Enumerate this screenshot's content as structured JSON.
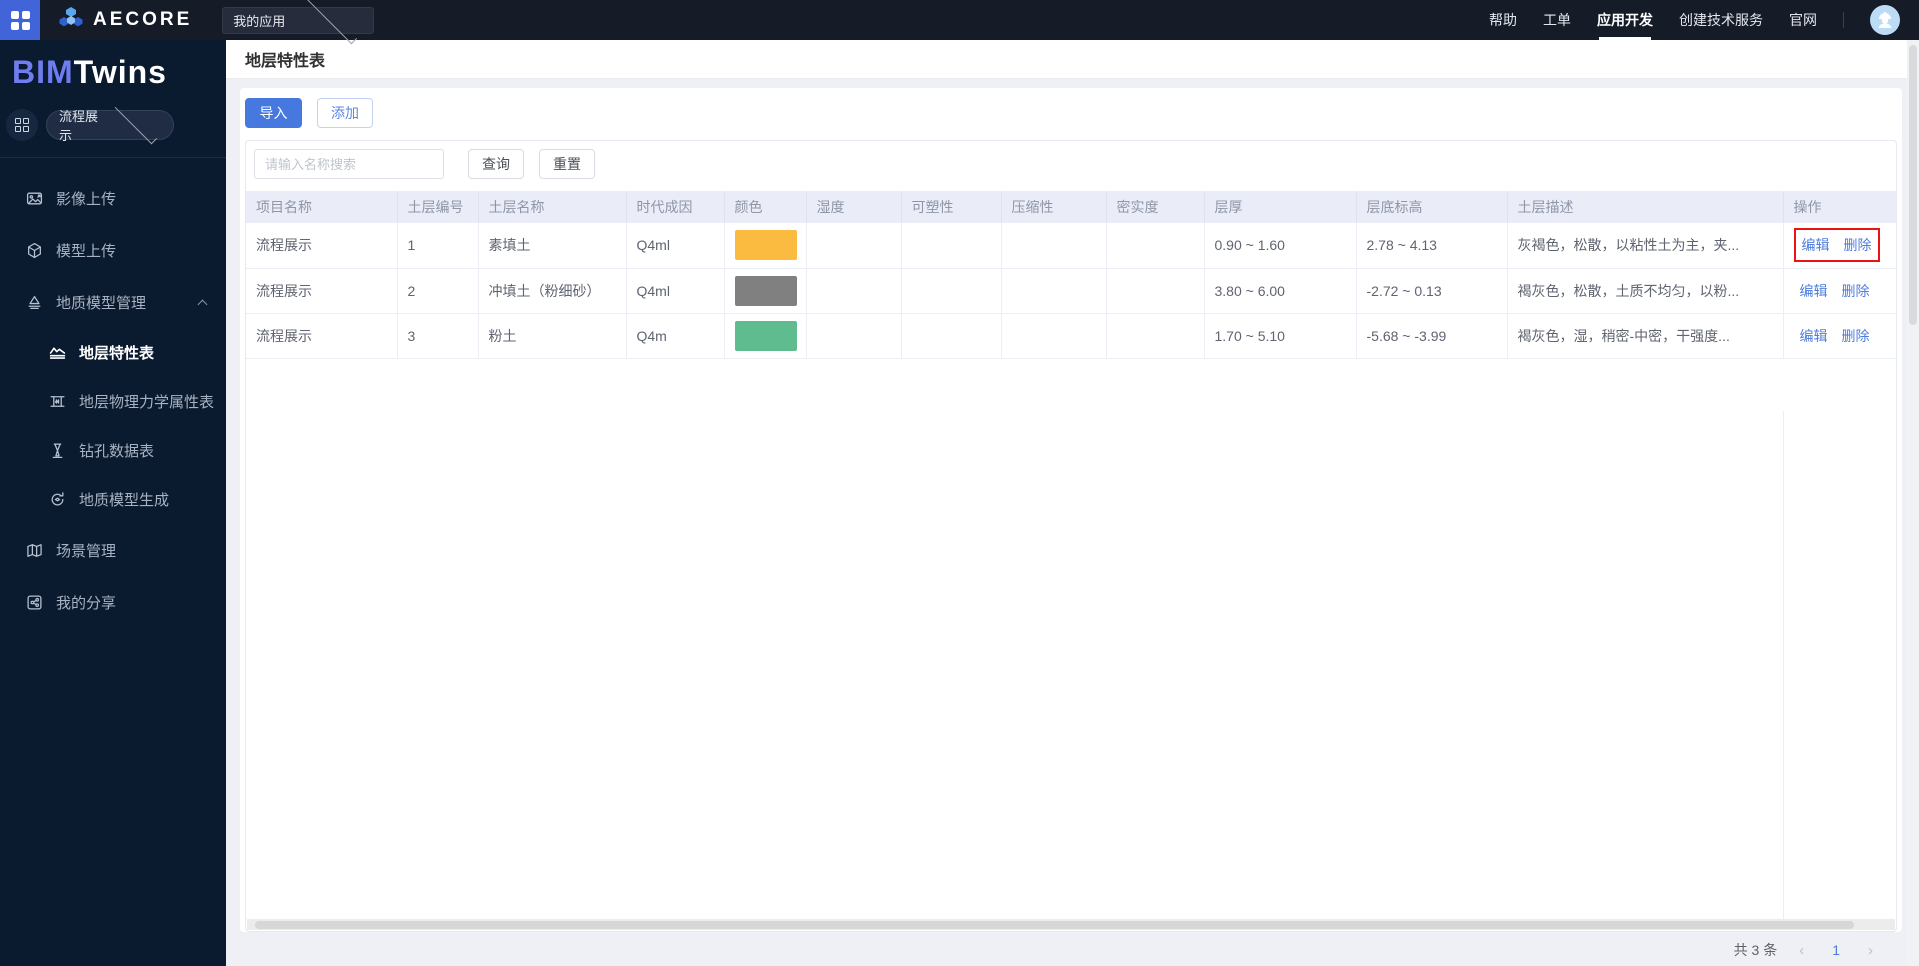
{
  "topbar": {
    "brand": "AECORE",
    "app_select_value": "我的应用",
    "nav": [
      {
        "label": "帮助",
        "active": false
      },
      {
        "label": "工单",
        "active": false
      },
      {
        "label": "应用开发",
        "active": true
      },
      {
        "label": "创建技术服务",
        "active": false
      },
      {
        "label": "官网",
        "active": false
      }
    ]
  },
  "sidebar": {
    "brand_bim": "BIM",
    "brand_twins": "Twins",
    "project_select_value": "流程展示",
    "items": [
      {
        "label": "影像上传",
        "icon": "image-upload-icon",
        "sub": false,
        "active": false,
        "expandable": false
      },
      {
        "label": "模型上传",
        "icon": "model-upload-icon",
        "sub": false,
        "active": false,
        "expandable": false
      },
      {
        "label": "地质模型管理",
        "icon": "geology-manage-icon",
        "sub": false,
        "active": false,
        "expandable": true
      },
      {
        "label": "地层特性表",
        "icon": "strata-feature-icon",
        "sub": true,
        "active": true,
        "expandable": false
      },
      {
        "label": "地层物理力学属性表",
        "icon": "strata-physics-icon",
        "sub": true,
        "active": false,
        "expandable": false
      },
      {
        "label": "钻孔数据表",
        "icon": "drill-data-icon",
        "sub": true,
        "active": false,
        "expandable": false
      },
      {
        "label": "地质模型生成",
        "icon": "model-generate-icon",
        "sub": true,
        "active": false,
        "expandable": false
      },
      {
        "label": "场景管理",
        "icon": "scene-manage-icon",
        "sub": false,
        "active": false,
        "expandable": false
      },
      {
        "label": "我的分享",
        "icon": "my-share-icon",
        "sub": false,
        "active": false,
        "expandable": false
      }
    ]
  },
  "page": {
    "title": "地层特性表",
    "import_label": "导入",
    "add_label": "添加",
    "search_placeholder": "请输入名称搜索",
    "query_label": "查询",
    "reset_label": "重置"
  },
  "table": {
    "columns": [
      {
        "key": "project",
        "label": "项目名称"
      },
      {
        "key": "layer_no",
        "label": "土层编号"
      },
      {
        "key": "name",
        "label": "土层名称"
      },
      {
        "key": "genesis",
        "label": "时代成因"
      },
      {
        "key": "color",
        "label": "颜色"
      },
      {
        "key": "moisture",
        "label": "湿度"
      },
      {
        "key": "plasticity",
        "label": "可塑性"
      },
      {
        "key": "compressibility",
        "label": "压缩性"
      },
      {
        "key": "density",
        "label": "密实度"
      },
      {
        "key": "thickness",
        "label": "层厚"
      },
      {
        "key": "bottom_elevation",
        "label": "层底标高"
      },
      {
        "key": "description",
        "label": "土层描述"
      },
      {
        "key": "actions",
        "label": "操作"
      }
    ],
    "edit_label": "编辑",
    "delete_label": "删除",
    "highlighted_row_index": 0,
    "rows": [
      {
        "project": "流程展示",
        "layer_no": "1",
        "name": "素填土",
        "genesis": "Q4ml",
        "color": "#fbbb40",
        "moisture": "",
        "plasticity": "",
        "compressibility": "",
        "density": "",
        "thickness": "0.90 ~ 1.60",
        "bottom_elevation": "2.78 ~ 4.13",
        "description": "灰褐色，松散，以粘性土为主，夹..."
      },
      {
        "project": "流程展示",
        "layer_no": "2",
        "name": "冲填土（粉细砂）",
        "genesis": "Q4ml",
        "color": "#808080",
        "moisture": "",
        "plasticity": "",
        "compressibility": "",
        "density": "",
        "thickness": "3.80 ~ 6.00",
        "bottom_elevation": "-2.72 ~ 0.13",
        "description": "褐灰色，松散，土质不均匀，以粉..."
      },
      {
        "project": "流程展示",
        "layer_no": "3",
        "name": "粉土",
        "genesis": "Q4m",
        "color": "#5fbc8e",
        "moisture": "",
        "plasticity": "",
        "compressibility": "",
        "density": "",
        "thickness": "1.70 ~ 5.10",
        "bottom_elevation": "-5.68 ~ -3.99",
        "description": "褐灰色，湿，稍密-中密，干强度..."
      }
    ]
  },
  "pagination": {
    "total_label": "共 3 条",
    "prev_label": "‹",
    "page": "1",
    "next_label": "›"
  },
  "colors": {
    "accent": "#4678e0",
    "link": "#4d7cdd",
    "highlight_box": "#ec1313",
    "header_bg": "#eaedf7",
    "topbar_bg": "#161b28",
    "sidebar_bg": "#0a1b2f"
  }
}
